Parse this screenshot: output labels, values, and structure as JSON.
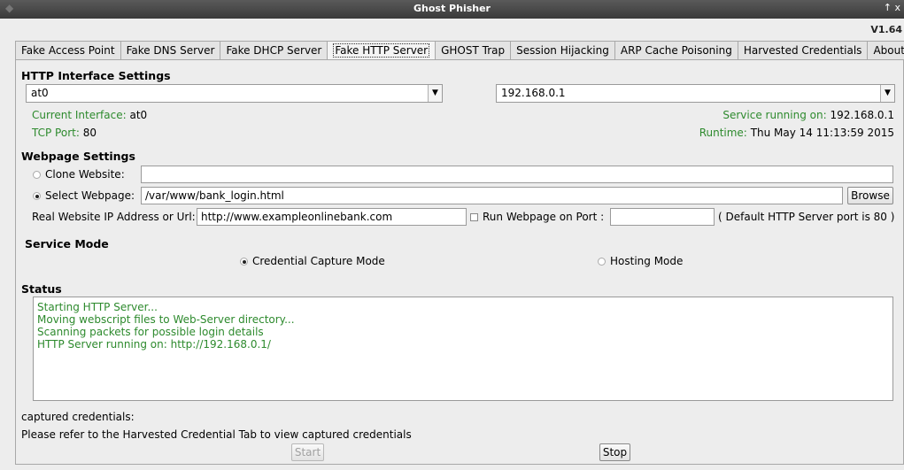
{
  "window": {
    "title": "Ghost Phisher",
    "version": "V1.64",
    "controls": "↑ x"
  },
  "tabs": [
    "Fake Access Point",
    "Fake DNS Server",
    "Fake DHCP Server",
    "Fake HTTP Server",
    "GHOST Trap",
    "Session Hijacking",
    "ARP Cache Poisoning",
    "Harvested Credentials",
    "About"
  ],
  "active_tab": "Fake HTTP Server",
  "interface_settings": {
    "heading": "HTTP Interface Settings",
    "interface_value": "at0",
    "ip_value": "192.168.0.1",
    "current_interface_label": "Current Interface:",
    "current_interface_value": "at0",
    "tcp_port_label": "TCP Port:",
    "tcp_port_value": "80",
    "service_running_label": "Service running on:",
    "service_running_value": "192.168.0.1",
    "runtime_label": "Runtime:",
    "runtime_value": "Thu May 14 11:13:59 2015"
  },
  "webpage_settings": {
    "heading": "Webpage Settings",
    "clone_label": "Clone Website:",
    "clone_value": "",
    "clone_selected": false,
    "select_label": "Select Webpage:",
    "select_value": "/var/www/bank_login.html",
    "select_selected": true,
    "browse_label": "Browse",
    "real_site_label": "Real Website IP Address or Url:",
    "real_site_value": "http://www.exampleonlinebank.com",
    "run_port_label": "Run Webpage on Port :",
    "run_port_checked": false,
    "run_port_value": "",
    "default_port_note": "( Default HTTP Server port is 80 )"
  },
  "service_mode": {
    "heading": "Service Mode",
    "credential_label": "Credential Capture Mode",
    "credential_selected": true,
    "hosting_label": "Hosting  Mode",
    "hosting_selected": false
  },
  "status": {
    "heading": "Status",
    "lines": [
      "Starting HTTP Server...",
      "Moving webscript files to Web-Server directory...",
      "Scanning packets for possible login details",
      "HTTP Server running on: http://192.168.0.1/"
    ]
  },
  "footer": {
    "captured_label": "captured credentials:",
    "refer_text": "Please refer to the Harvested Credential Tab to view captured credentials",
    "start_label": "Start",
    "stop_label": "Stop"
  }
}
